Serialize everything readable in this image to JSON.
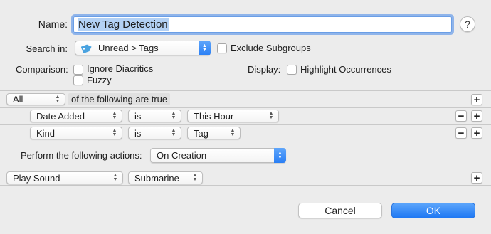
{
  "header": {
    "name_label": "Name:",
    "name_value": "New Tag Detection",
    "help_label": "?"
  },
  "search": {
    "label": "Search in:",
    "value": "Unread > Tags",
    "icon": "tag-icon",
    "exclude_subgroups": {
      "label": "Exclude Subgroups",
      "checked": false
    }
  },
  "comparison": {
    "label": "Comparison:",
    "options": [
      {
        "label": "Ignore Diacritics",
        "checked": false
      },
      {
        "label": "Fuzzy",
        "checked": false
      }
    ]
  },
  "display": {
    "label": "Display:",
    "highlight": {
      "label": "Highlight Occurrences",
      "checked": false
    }
  },
  "match": {
    "mode": "All",
    "suffix": "of the following are true"
  },
  "conditions": [
    {
      "field": "Date Added",
      "operator": "is",
      "value": "This Hour"
    },
    {
      "field": "Kind",
      "operator": "is",
      "value": "Tag"
    }
  ],
  "actions": {
    "label": "Perform the following actions:",
    "timing": "On Creation",
    "rows": [
      {
        "action": "Play Sound",
        "param": "Submarine"
      }
    ]
  },
  "buttons": {
    "add": "+",
    "remove": "−",
    "cancel": "Cancel",
    "ok": "OK"
  },
  "colors": {
    "accent": "#2a7ff5",
    "selection": "#b3d1f5",
    "tag_icon": "#4aa3e0"
  }
}
